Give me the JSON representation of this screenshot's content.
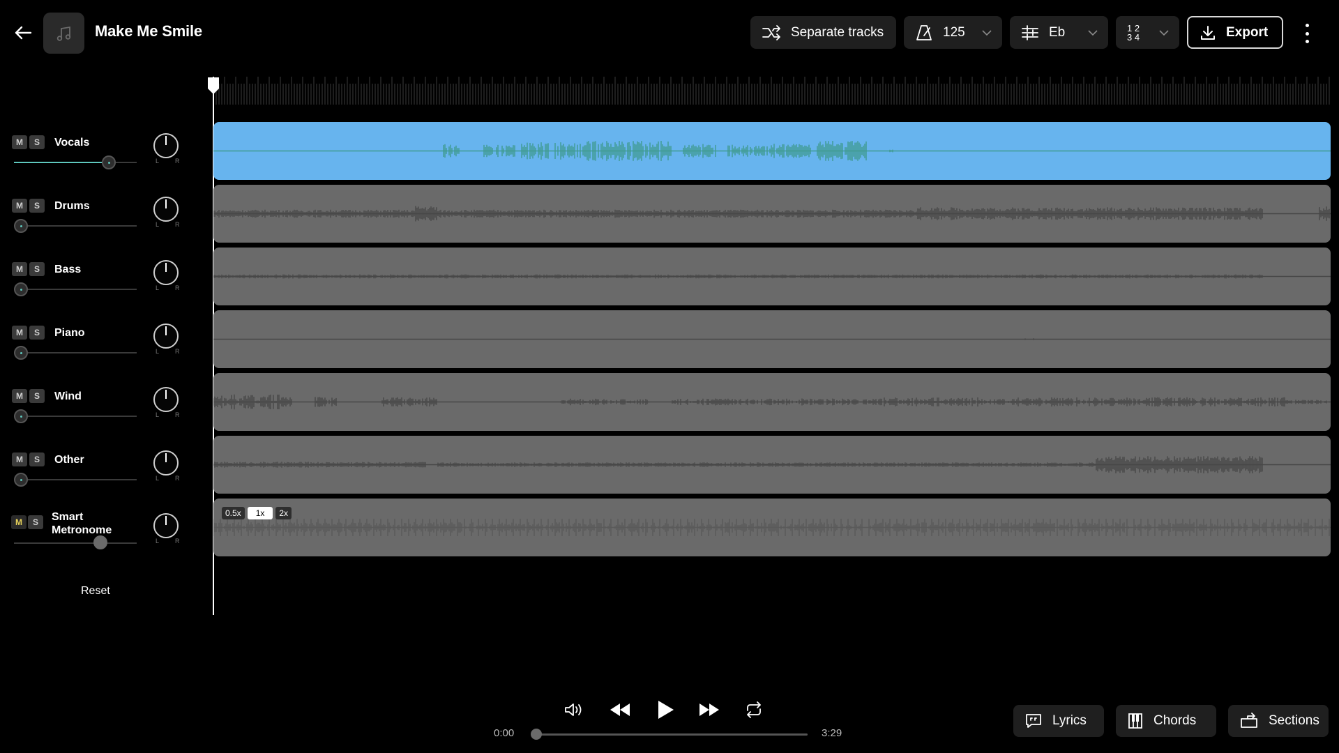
{
  "header": {
    "song_title": "Make Me Smile",
    "separate_label": "Separate tracks",
    "tempo": "125",
    "key": "Eb",
    "meter_top": "1 2",
    "meter_bottom": "3 4",
    "export_label": "Export"
  },
  "tracks": [
    {
      "name": "Vocals",
      "mute": "M",
      "solo": "S",
      "volume": 0.77,
      "selected": true
    },
    {
      "name": "Drums",
      "mute": "M",
      "solo": "S",
      "volume": 0.0
    },
    {
      "name": "Bass",
      "mute": "M",
      "solo": "S",
      "volume": 0.0
    },
    {
      "name": "Piano",
      "mute": "M",
      "solo": "S",
      "volume": 0.0
    },
    {
      "name": "Wind",
      "mute": "M",
      "solo": "S",
      "volume": 0.0
    },
    {
      "name": "Other",
      "mute": "M",
      "solo": "S",
      "volume": 0.0
    },
    {
      "name_line1": "Smart",
      "name_line2": "Metronome",
      "mute": "M",
      "solo": "S",
      "volume": 0.72,
      "mute_active": true
    }
  ],
  "pan_left": "L",
  "pan_right": "R",
  "reset_label": "Reset",
  "speeds": [
    "0.5x",
    "1x",
    "2x"
  ],
  "transport": {
    "time_current": "0:00",
    "time_total": "3:29",
    "progress": 0.0
  },
  "bottom_buttons": {
    "lyrics": "Lyrics",
    "chords": "Chords",
    "sections": "Sections"
  },
  "colors": {
    "selected_lane": "#67b4ee",
    "vocal_wave": "#3f9a8f",
    "lane_gray": "#6a6a6a",
    "wave_gray": "#474747",
    "accent": "#5ec7bd",
    "mute_active": "#e8d35a"
  },
  "icons": [
    "back-arrow-icon",
    "music-note-icon",
    "split-icon",
    "metronome-icon",
    "sliders-icon",
    "chevron-down-icon",
    "download-icon",
    "kebab-icon",
    "volume-icon",
    "rewind-icon",
    "play-icon",
    "fast-forward-icon",
    "loop-icon",
    "lyrics-icon",
    "chords-icon",
    "sections-icon"
  ]
}
